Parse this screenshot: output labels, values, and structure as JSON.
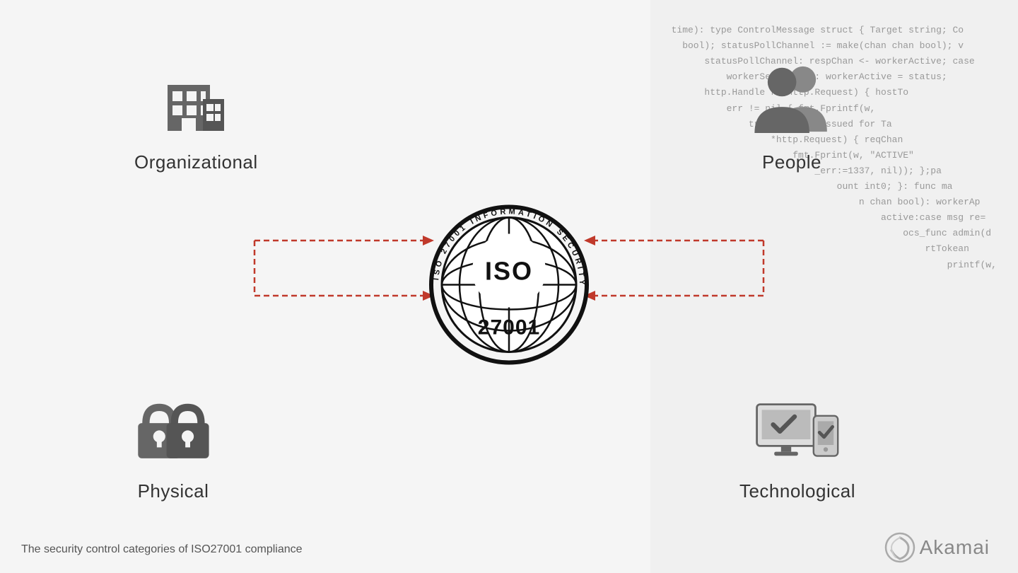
{
  "code_lines": [
    "time): type ControlMessage struct { Target string; Co",
    "    bool); statusPollChannel := make(chan chan bool); v",
    "        statusPollChannel: respChan <- workerActive; case",
    "            workerSelectChan: workerActive = status;",
    "        http.Handle r *http.Request) { hostTo",
    "            err != nil { fmt.Fprintf(w,",
    "                trol message issued for Ta",
    "                    *http.Request) { reqChan",
    "                        fmt.Fprint(w, \"ACTIVE\"",
    "                            _err:=1337, nil)); };pa",
    "                                ount int0; }: func ma",
    "                                    n chan bool): workerAp",
    "                                        active:case msg re=",
    "                                            ocs_func admin(d",
    "                                                rtTokean",
    "                                                    printf(w,"
  ],
  "corners": {
    "organizational": {
      "label": "Organizational"
    },
    "people": {
      "label": "People"
    },
    "physical": {
      "label": "Physical"
    },
    "technological": {
      "label": "Technological"
    }
  },
  "iso": {
    "ring_text": "ISO 27001 INFORMATION SECURITY",
    "number": "27001",
    "abbr": "ISO"
  },
  "caption": "The security control categories of ISO27001 compliance",
  "brand": {
    "name": "Akamai"
  },
  "colors": {
    "red_arrow": "#c0392b",
    "icon_gray": "#666666",
    "icon_dark": "#555555"
  }
}
